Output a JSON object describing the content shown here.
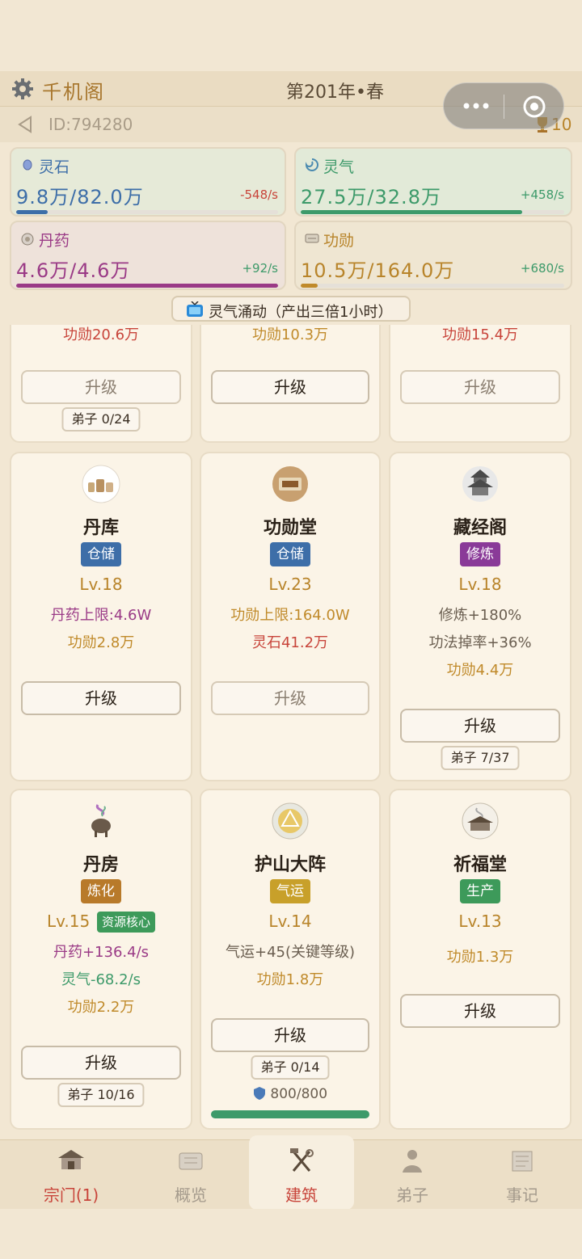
{
  "header": {
    "title": "千机阁",
    "year": "第201年•春",
    "uid": "ID:794280",
    "trophy_count": "10"
  },
  "resources": [
    {
      "name": "灵石",
      "value": "9.8万/82.0万",
      "rate": "-548/s",
      "progress": 0.12,
      "color": "#3d6ea8",
      "rate_color": "#c8443a"
    },
    {
      "name": "灵气",
      "value": "27.5万/32.8万",
      "rate": "+458/s",
      "progress": 0.84,
      "color": "#3d9a6a",
      "rate_color": "#3d9a6a"
    },
    {
      "name": "丹药",
      "value": "4.6万/4.6万",
      "rate": "+92/s",
      "progress": 1.0,
      "color": "#9a3a86",
      "rate_color": "#3d9a6a"
    },
    {
      "name": "功勋",
      "value": "10.5万/164.0万",
      "rate": "+680/s",
      "progress": 0.064,
      "color": "#c08a2a",
      "rate_color": "#3d9a6a"
    }
  ],
  "notice": "灵气涌动（产出三倍1小时）",
  "cards_top": [
    {
      "cost": "功勋20.6万",
      "cost_color": "#c8443a",
      "button": "升级",
      "disciples": "弟子 0/24"
    },
    {
      "cost": "功勋10.3万",
      "cost_color": "#c08a2a",
      "button": "升级",
      "disciples": ""
    },
    {
      "cost": "功勋15.4万",
      "cost_color": "#c8443a",
      "button": "升级",
      "disciples": ""
    }
  ],
  "cards_mid": [
    {
      "name": "丹库",
      "tag": "仓储",
      "tag_color": "#3d6ea8",
      "level": "Lv.18",
      "lines": [
        "丹药上限:4.6W",
        "功勋2.8万"
      ],
      "line_colors": [
        "#9a3a86",
        "#c08a2a"
      ],
      "button": "升级",
      "disciples": ""
    },
    {
      "name": "功勋堂",
      "tag": "仓储",
      "tag_color": "#3d6ea8",
      "level": "Lv.23",
      "lines": [
        "功勋上限:164.0W",
        "灵石41.2万"
      ],
      "line_colors": [
        "#c08a2a",
        "#c8443a"
      ],
      "button": "升级",
      "disciples": ""
    },
    {
      "name": "藏经阁",
      "tag": "修炼",
      "tag_color": "#8a3a98",
      "level": "Lv.18",
      "lines": [
        "修炼+180%",
        "功法掉率+36%",
        "功勋4.4万"
      ],
      "line_colors": [
        "#6a5e50",
        "#6a5e50",
        "#c08a2a"
      ],
      "button": "升级",
      "disciples": "弟子 7/37"
    }
  ],
  "cards_bot": [
    {
      "name": "丹房",
      "tag": "炼化",
      "tag_color": "#b87a2a",
      "badge": "资源核心",
      "level": "Lv.15",
      "lines": [
        "丹药+136.4/s",
        "灵气-68.2/s",
        "功勋2.2万"
      ],
      "line_colors": [
        "#9a3a86",
        "#3d9a6a",
        "#c08a2a"
      ],
      "button": "升级",
      "disciples": "弟子 10/16"
    },
    {
      "name": "护山大阵",
      "tag": "气运",
      "tag_color": "#c8a02a",
      "level": "Lv.14",
      "lines": [
        "气运+45(关键等级)",
        "功勋1.8万"
      ],
      "line_colors": [
        "#6a5e50",
        "#c08a2a"
      ],
      "button": "升级",
      "disciples": "弟子 0/14",
      "shield": "800/800",
      "shield_progress": 1.0
    },
    {
      "name": "祈福堂",
      "tag": "生产",
      "tag_color": "#3d9a5a",
      "level": "Lv.13",
      "lines": [
        "功勋1.3万"
      ],
      "line_colors": [
        "#c08a2a"
      ],
      "button": "升级",
      "disciples": ""
    }
  ],
  "tabs": [
    {
      "label": "宗门(1)",
      "icon": "sect-icon",
      "color": "#c8443a"
    },
    {
      "label": "概览",
      "icon": "scroll-icon",
      "color": "#a49a8c"
    },
    {
      "label": "建筑",
      "icon": "tools-icon",
      "color": "#c8443a"
    },
    {
      "label": "弟子",
      "icon": "disciple-icon",
      "color": "#a49a8c"
    },
    {
      "label": "事记",
      "icon": "record-icon",
      "color": "#a49a8c"
    }
  ]
}
